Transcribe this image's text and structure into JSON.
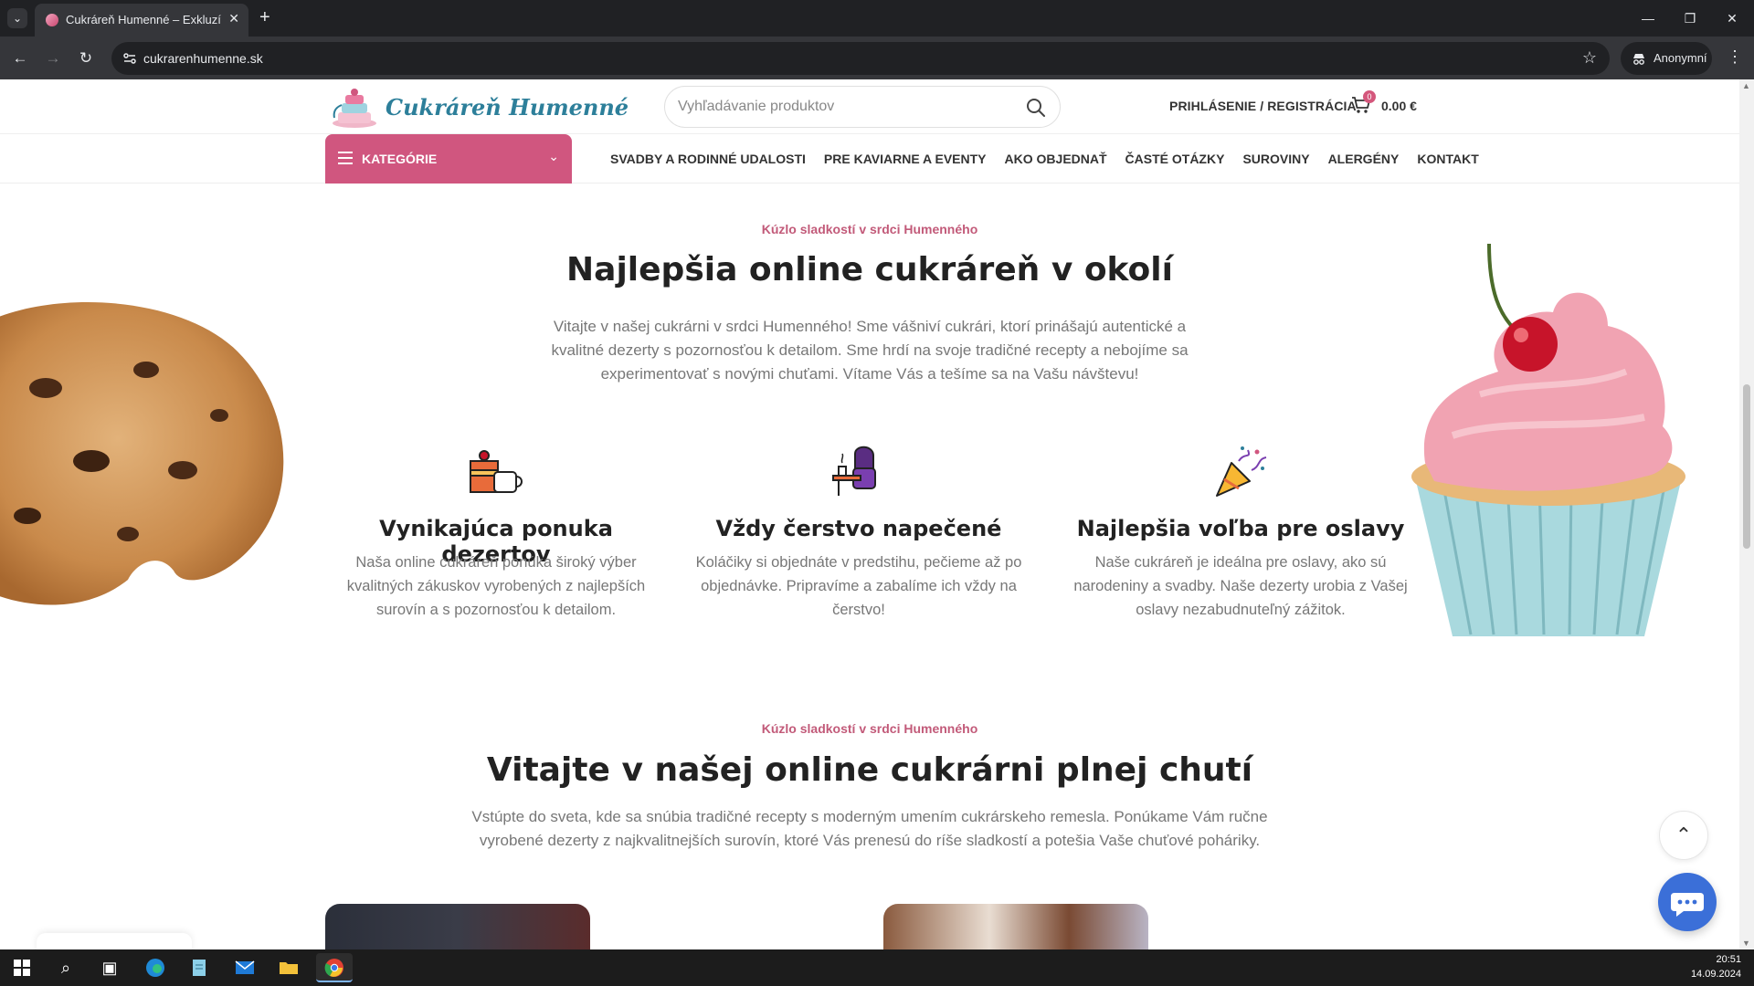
{
  "browser": {
    "tab_title": "Cukráreň Humenné – Exkluzívn",
    "url": "cukrarenhumenne.sk",
    "profile_label": "Anonymní"
  },
  "header": {
    "logo_text": "Cukráreň Humenné",
    "search_placeholder": "Vyhľadávanie produktov",
    "login_label": "PRIHLÁSENIE / REGISTRÁCIA",
    "cart_count": "0",
    "cart_total": "0.00 €"
  },
  "nav": {
    "categories_label": "KATEGÓRIE",
    "items": [
      "SVADBY A RODINNÉ UDALOSTI",
      "PRE KAVIARNE A EVENTY",
      "AKO OBJEDNAŤ",
      "ČASTÉ OTÁZKY",
      "SUROVINY",
      "ALERGÉNY",
      "KONTAKT"
    ]
  },
  "section1": {
    "eyebrow": "Kúzlo sladkostí v srdci Humenného",
    "title": "Najlepšia online cukráreň v okolí",
    "lead": "Vitajte v našej cukrárni v srdci Humenného! Sme vášniví cukrári, ktorí prinášajú autentické a kvalitné dezerty s pozornosťou k detailom. Sme hrdí na svoje tradičné recepty a nebojíme sa experimentovať s novými chuťami. Vítame Vás a tešíme sa na Vašu návštevu!",
    "features": [
      {
        "icon": "cake-coffee-icon",
        "title": "Vynikajúca ponuka dezertov",
        "text": "Naša online cukráreň ponúka široký výber kvalitných zákuskov vyrobených z najlepších surovín a s pozornosťou k detailom."
      },
      {
        "icon": "person-at-table-icon",
        "title": "Vždy čerstvo napečené",
        "text": "Koláčiky si objednáte v predstihu, pečieme až po objednávke. Pripravíme a zabalíme ich vždy na čerstvo!"
      },
      {
        "icon": "party-popper-icon",
        "title": "Najlepšia voľba pre oslavy",
        "text": "Naše cukráreň je ideálna pre oslavy, ako sú narodeniny a svadby. Naše dezerty urobia z Vašej oslavy nezabudnuteľný zážitok."
      }
    ]
  },
  "section2": {
    "eyebrow": "Kúzlo sladkostí v srdci Humenného",
    "title": "Vitajte v našej online cukrárni plnej chutí",
    "lead": "Vstúpte do sveta, kde sa snúbia tradičné recepty s moderným umením cukrárskeho remesla. Ponúkame Vám ručne vyrobené dezerty z najkvalitnejších surovín, ktoré Vás prenesú do ríše sladkostí a potešia Vaše chuťové poháriky."
  },
  "taskbar": {
    "time": "20:51",
    "date": "14.09.2024"
  },
  "colors": {
    "accent": "#d0567f",
    "eyebrow": "#c25a79",
    "chat": "#3b6fd8"
  }
}
